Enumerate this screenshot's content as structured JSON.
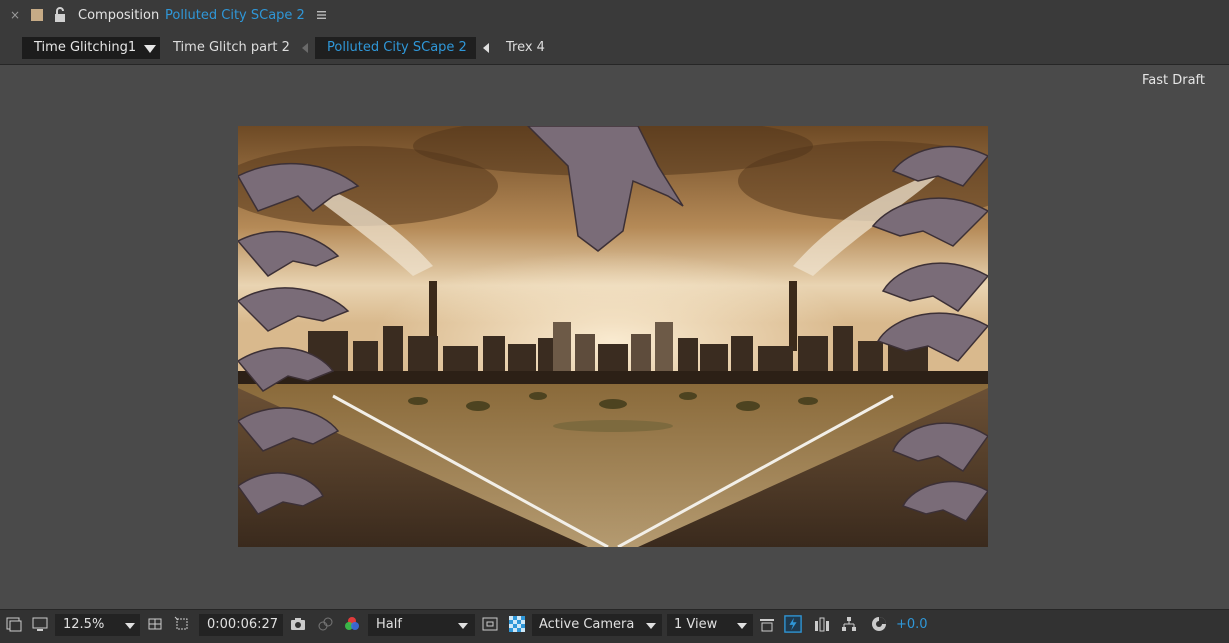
{
  "header": {
    "close_glyph": "×",
    "label": "Composition",
    "comp_name": "Polluted City SCape 2",
    "icons": [
      "close-icon",
      "color-swatch-icon",
      "lock-icon",
      "panel-menu-icon"
    ]
  },
  "tabs": [
    {
      "label": "Time Glitching1",
      "state": "dark"
    },
    {
      "label": "Time Glitch part 2",
      "state": "normal"
    },
    {
      "label": "Polluted City SCape 2",
      "state": "active"
    },
    {
      "label": "Trex 4",
      "state": "normal"
    }
  ],
  "viewer": {
    "renderer_label": "Fast Draft",
    "content": "composition-frame"
  },
  "toolbar": {
    "magnification": "12.5%",
    "timecode": "0:00:06:27",
    "resolution": "Half",
    "camera": "Active Camera",
    "views": "1 View",
    "exposure": "+0.0"
  },
  "colors": {
    "accent": "#2f97d8",
    "panel_bg": "#4a4a4a",
    "header_bg": "#3a3a3a",
    "toolbar_bg": "#323232"
  }
}
